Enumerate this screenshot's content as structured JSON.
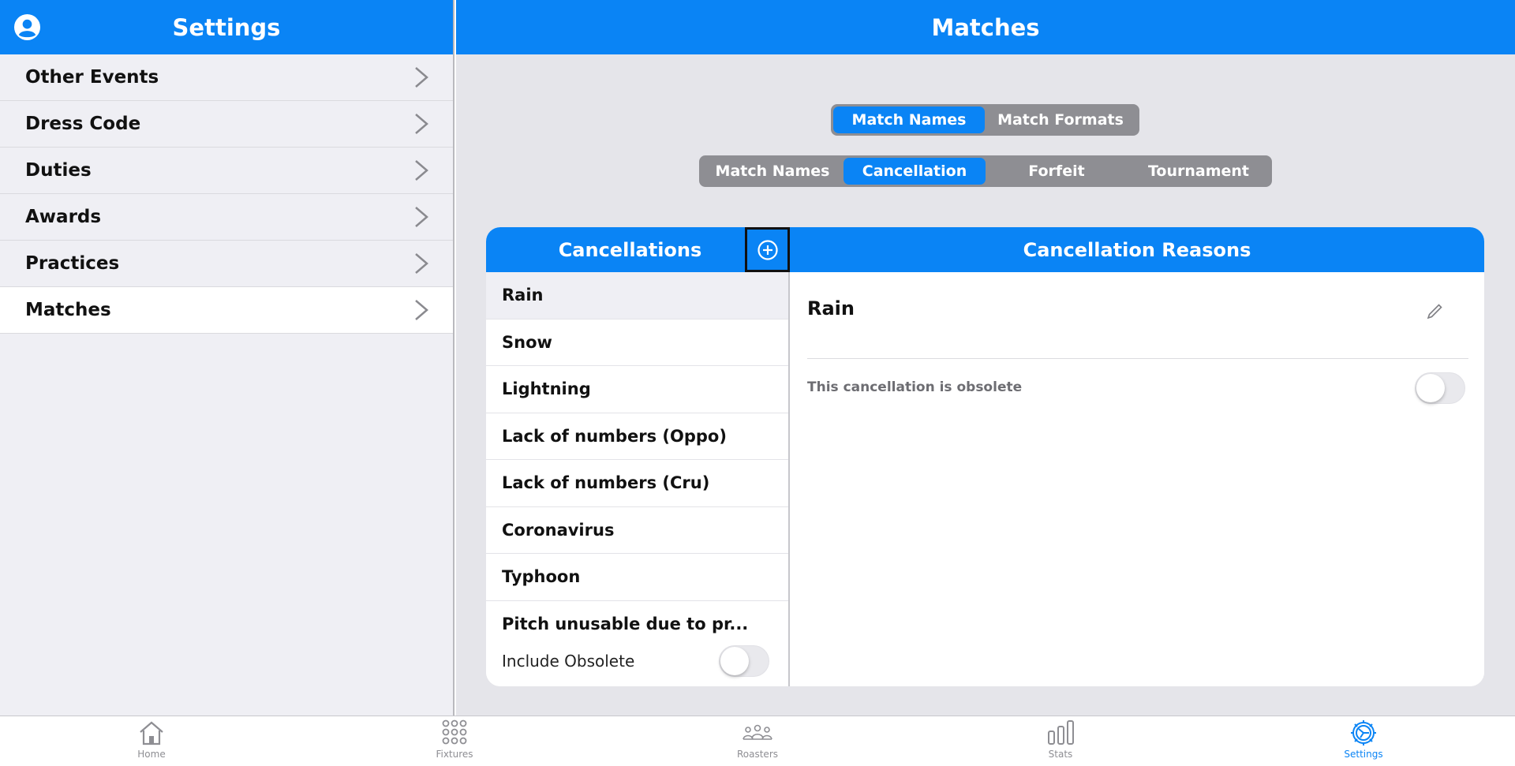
{
  "sidebar": {
    "title": "Settings",
    "items": [
      {
        "label": "Other Events"
      },
      {
        "label": "Dress Code"
      },
      {
        "label": "Duties"
      },
      {
        "label": "Awards"
      },
      {
        "label": "Practices"
      },
      {
        "label": "Matches",
        "active": true
      }
    ]
  },
  "main": {
    "title": "Matches",
    "segment1": {
      "options": [
        "Match Names",
        "Match Formats"
      ],
      "selected": "Match Names"
    },
    "segment2": {
      "options": [
        "Match Names",
        "Cancellation",
        "Forfeit",
        "Tournament"
      ],
      "selected": "Cancellation"
    },
    "card": {
      "left_header": "Cancellations",
      "right_header": "Cancellation Reasons",
      "list": [
        "Rain",
        "Snow",
        "Lightning",
        "Lack of numbers (Oppo)",
        "Lack of numbers (Cru)",
        "Coronavirus",
        "Typhoon",
        "Pitch unusable due to pr..."
      ],
      "selected": "Rain",
      "include_obsolete_label": "Include Obsolete",
      "include_obsolete_on": false,
      "detail": {
        "name": "Rain",
        "obsolete_label": "This cancellation is obsolete",
        "obsolete_on": false
      }
    }
  },
  "tabbar": {
    "tabs": [
      {
        "label": "Home",
        "icon": "home-icon"
      },
      {
        "label": "Fixtures",
        "icon": "grid-icon"
      },
      {
        "label": "Roasters",
        "icon": "people-icon"
      },
      {
        "label": "Stats",
        "icon": "bar-chart-icon"
      },
      {
        "label": "Settings",
        "icon": "settings-gear-icon",
        "active": true
      }
    ]
  },
  "colors": {
    "accent": "#0a84f5",
    "segment_bg": "#8e8e93",
    "panel_bg": "#e5e5ea",
    "sidebar_bg": "#efeff4"
  }
}
